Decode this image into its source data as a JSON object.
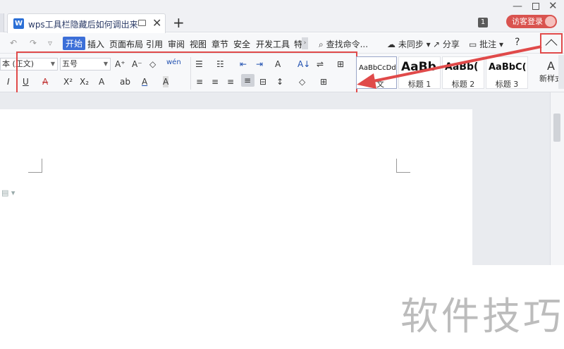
{
  "window": {
    "tab_title": "wps工具栏隐藏后如何调出来",
    "tab_icon": "W",
    "new_tab": "+",
    "min": "—",
    "close": "✕",
    "badge": "1",
    "login": "访客登录"
  },
  "menu": {
    "quick": [
      "↶",
      "↷",
      "▿"
    ],
    "items": [
      "开始",
      "插入",
      "页面布局",
      "引用",
      "审阅",
      "视图",
      "章节",
      "安全",
      "开发工具",
      "特"
    ],
    "more": "›",
    "search": "查找命令...",
    "sync": "未同步",
    "share": "分享",
    "comment": "批注",
    "help": "?"
  },
  "ribbon": {
    "font_name": "本 (正文)",
    "font_size": "五号",
    "row1": {
      "grow": "A⁺",
      "shrink": "A⁻",
      "clear": "◇",
      "phonetic": "wén",
      "bullets": "☰",
      "numbering": "☷",
      "outdent": "⇤",
      "indent": "⇥",
      "char_shade": "A",
      "sort": "A↓",
      "spacing": "⇌",
      "table": "⊞"
    },
    "row2": {
      "italic": "I",
      "underline": "U",
      "strike": "A",
      "superscript": "X²",
      "subscript": "X₂",
      "effect": "A",
      "highlight": "ab",
      "font_color": "A",
      "char_border": "A",
      "align_left": "≡",
      "align_center": "≡",
      "align_right": "≡",
      "align_justify": "≡",
      "distributed": "⊟",
      "line_spacing": "↕",
      "fill": "◇",
      "border": "⊞"
    }
  },
  "styles": {
    "items": [
      {
        "sample": "AaBbCcDd",
        "name": "正文"
      },
      {
        "sample": "AaBb",
        "name": "标题 1"
      },
      {
        "sample": "AaBb(",
        "name": "标题 2"
      },
      {
        "sample": "AaBbC(",
        "name": "标题 3"
      }
    ],
    "new_style": "新样式"
  },
  "watermark": "软件技巧",
  "colors": {
    "accent": "#3c6fd8",
    "highlight": "#e04a4a",
    "login": "#d9534f"
  }
}
